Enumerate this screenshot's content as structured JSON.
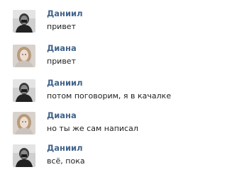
{
  "messages": [
    {
      "author": "Даниил",
      "text": "привет",
      "avatar": "daniil-avatar"
    },
    {
      "author": "Диана",
      "text": "привет",
      "avatar": "diana-avatar"
    },
    {
      "author": "Даниил",
      "text": "потом поговорим, я в качалке",
      "avatar": "daniil-avatar"
    },
    {
      "author": "Диана",
      "text": "но ты же сам написал",
      "avatar": "diana-avatar"
    },
    {
      "author": "Даниил",
      "text": "всё, пока",
      "avatar": "daniil-avatar"
    }
  ],
  "colors": {
    "author": "#42648b",
    "text": "#1f1f1f",
    "background": "#ffffff"
  }
}
